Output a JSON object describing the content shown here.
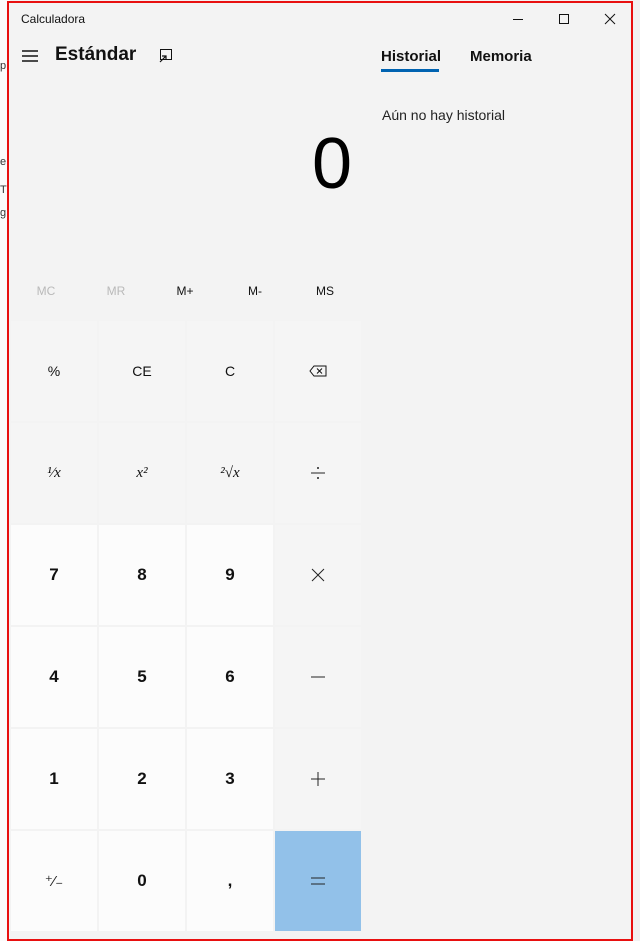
{
  "window": {
    "title": "Calculadora"
  },
  "header": {
    "mode_title": "Estándar"
  },
  "tabs": [
    {
      "label": "Historial",
      "active": true
    },
    {
      "label": "Memoria",
      "active": false
    }
  ],
  "history": {
    "empty_text": "Aún no hay historial"
  },
  "display": {
    "value": "0"
  },
  "memory": [
    {
      "label": "MC",
      "enabled": false
    },
    {
      "label": "MR",
      "enabled": false
    },
    {
      "label": "M+",
      "enabled": true
    },
    {
      "label": "M-",
      "enabled": true
    },
    {
      "label": "MS",
      "enabled": true
    }
  ],
  "keys": {
    "percent": "%",
    "clear_entry": "CE",
    "clear": "C",
    "reciprocal": "¹⁄x",
    "square": "x²",
    "sqrt": "²√x",
    "n7": "7",
    "n8": "8",
    "n9": "9",
    "n4": "4",
    "n5": "5",
    "n6": "6",
    "n1": "1",
    "n2": "2",
    "n3": "3",
    "negate": "⁺⁄₋",
    "n0": "0",
    "decimal": ","
  },
  "colors": {
    "accent": "#0063b1",
    "equals_bg": "#92c1e9",
    "window_border": "#e81010"
  },
  "background_fragments": [
    "p",
    "e",
    "TI",
    "g"
  ]
}
